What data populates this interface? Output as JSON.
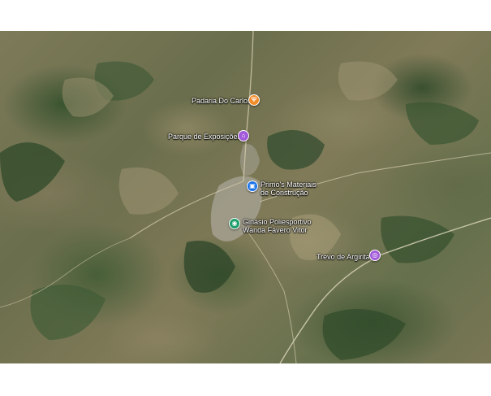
{
  "map": {
    "markers": [
      {
        "label": "Padaria Do Carlos",
        "icon": "bakery-icon",
        "color": "#f28c28",
        "glyph": "Ψ"
      },
      {
        "label": "Parque de Exposições",
        "icon": "attraction-icon",
        "color": "#a259d9",
        "glyph": "⌂"
      },
      {
        "label_line1": "Primo's Materiais",
        "label_line2": "de Construção",
        "icon": "shopping-bag-icon",
        "color": "#1a73e8",
        "glyph": "▣"
      },
      {
        "label_line1": "Ginásio Poliesportivo",
        "label_line2": "Wanda Fávero Vitor",
        "icon": "sports-icon",
        "color": "#1e9e6a",
        "glyph": "◉"
      },
      {
        "label": "Trevo de Argirita",
        "icon": "camera-icon",
        "color": "#a259d9",
        "glyph": "◎"
      }
    ]
  }
}
